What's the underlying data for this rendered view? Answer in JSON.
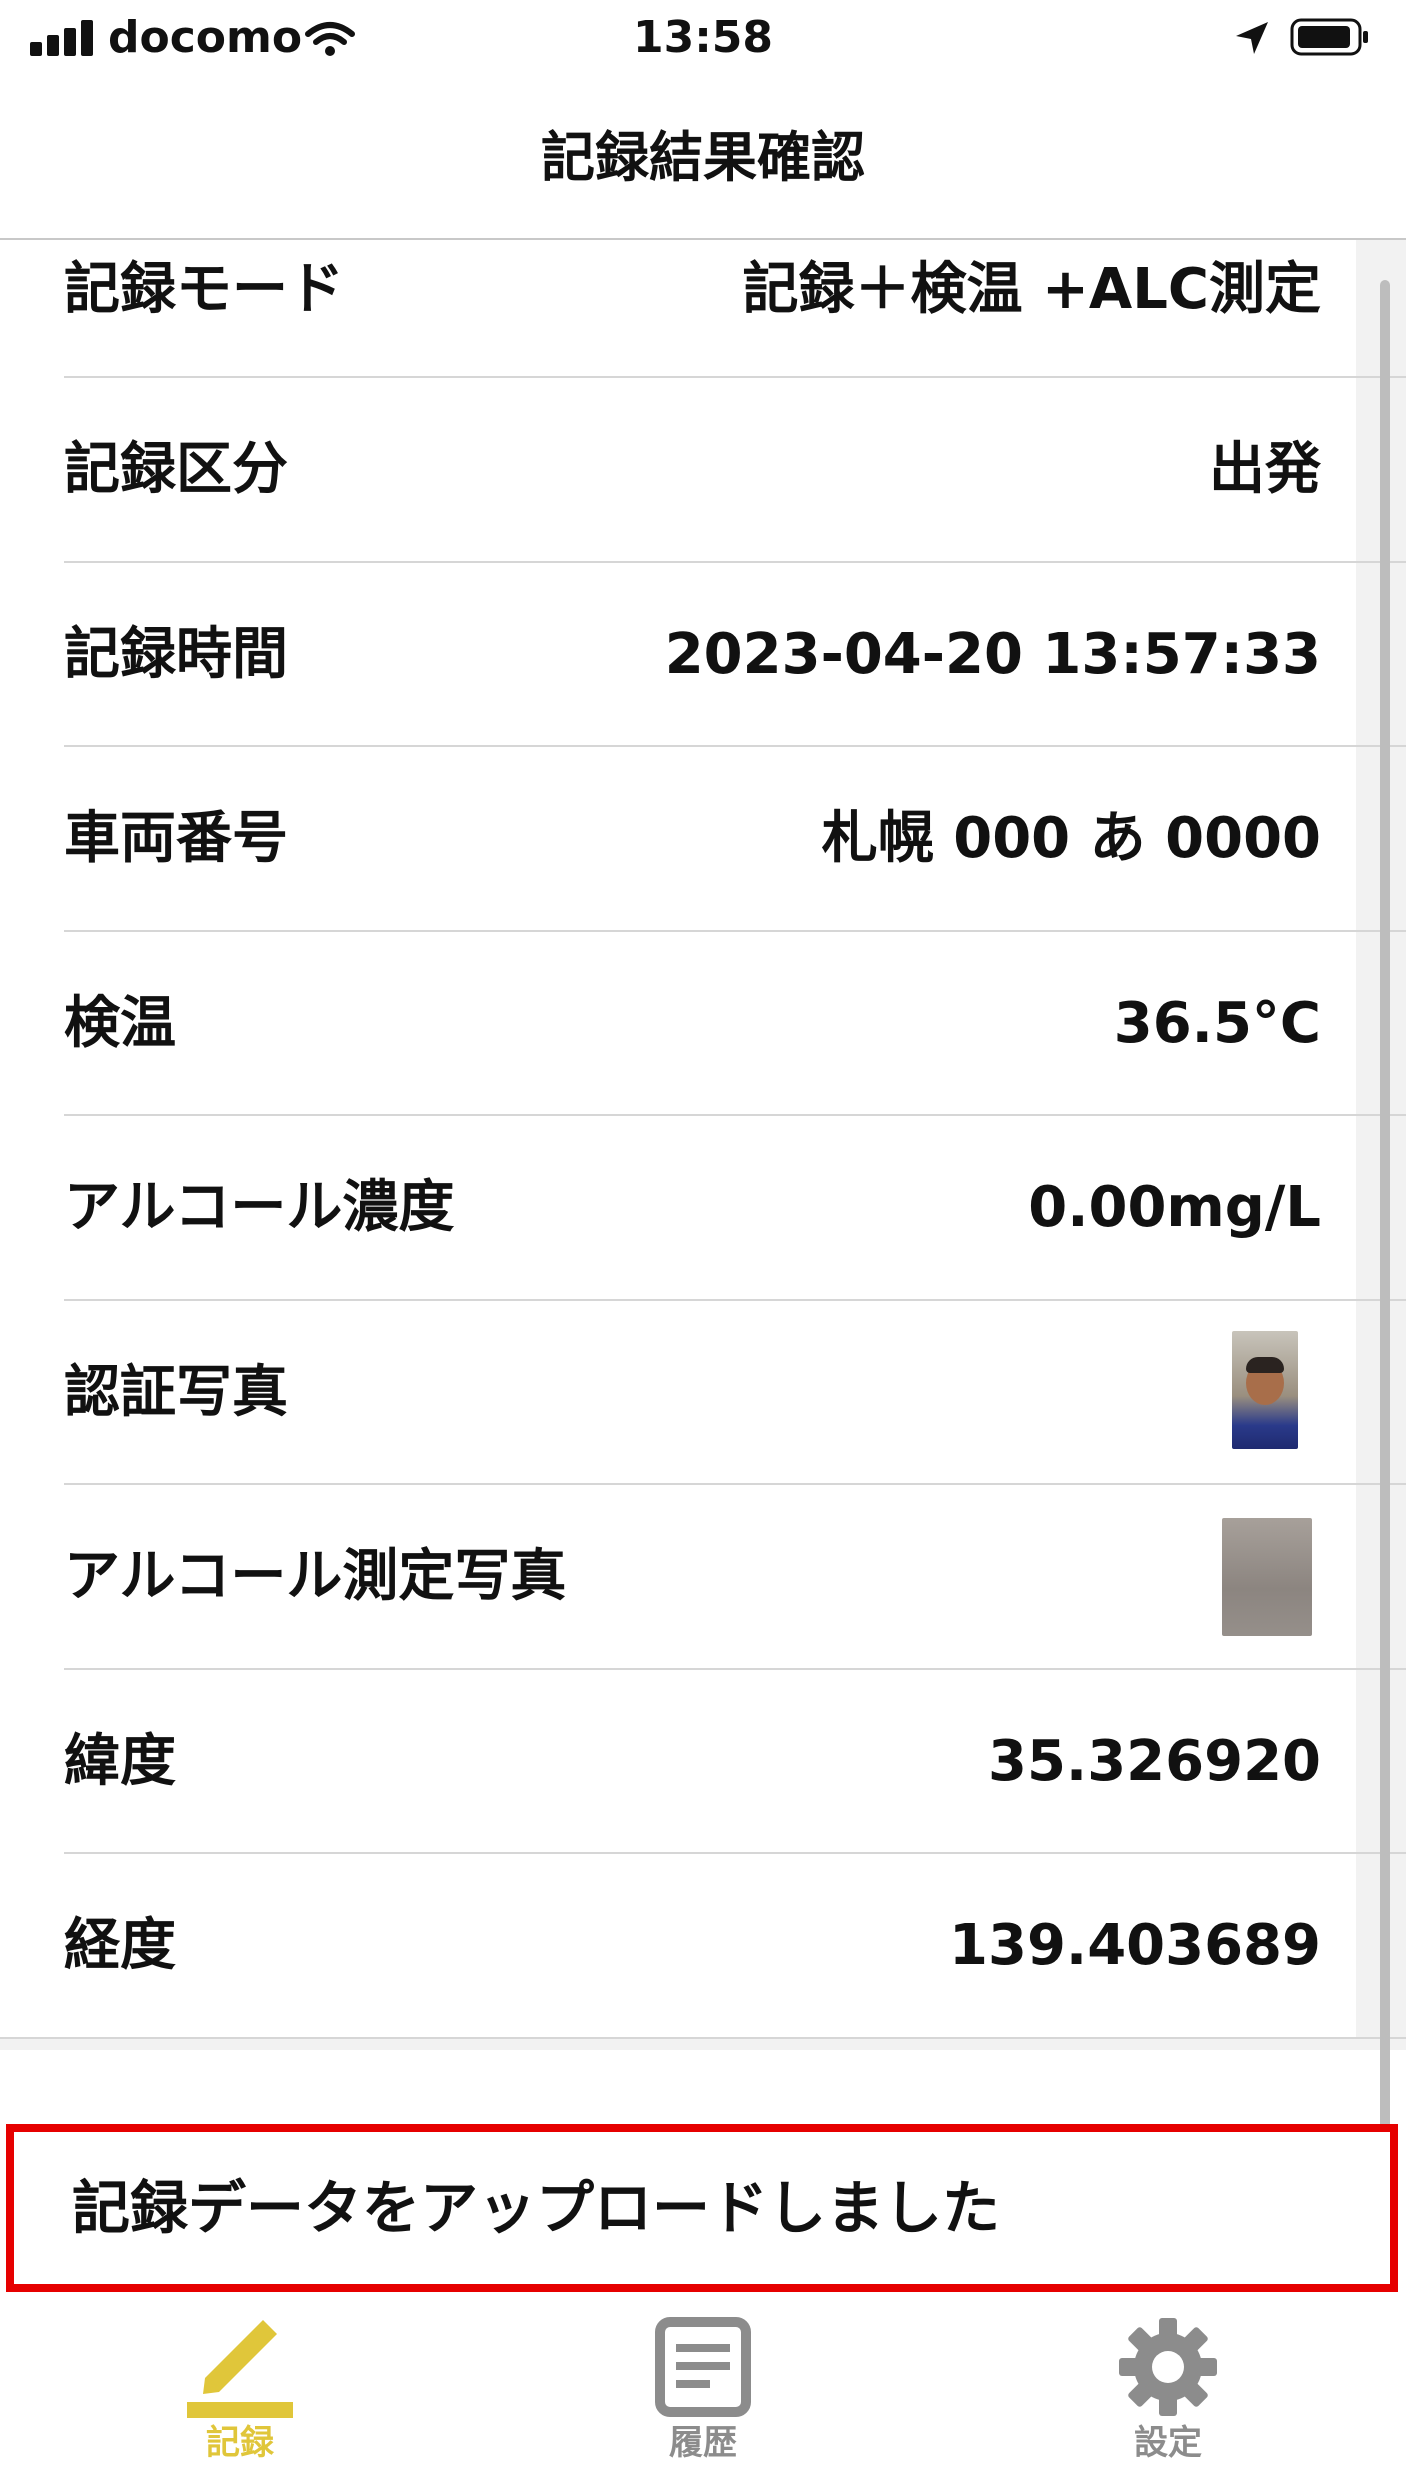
{
  "status_bar": {
    "carrier": "docomo",
    "time": "13:58"
  },
  "nav": {
    "title": "記録結果確認"
  },
  "rows": [
    {
      "label": "記録モード",
      "value": "記録＋検温 +ALC測定"
    },
    {
      "label": "記録区分",
      "value": "出発"
    },
    {
      "label": "記録時間",
      "value": "2023-04-20 13:57:33"
    },
    {
      "label": "車両番号",
      "value": "札幌 000 あ 0000"
    },
    {
      "label": "検温",
      "value": "36.5°C"
    },
    {
      "label": "アルコール濃度",
      "value": "0.00mg/L"
    },
    {
      "label": "認証写真"
    },
    {
      "label": "アルコール測定写真"
    },
    {
      "label": "緯度",
      "value": "35.326920"
    },
    {
      "label": "経度",
      "value": "139.403689"
    }
  ],
  "toast": {
    "message": "記録データをアップロードしました"
  },
  "tab_bar": {
    "items": [
      {
        "label": "記録",
        "icon": "pencil-icon",
        "active": true
      },
      {
        "label": "履歴",
        "icon": "document-icon",
        "active": false
      },
      {
        "label": "設定",
        "icon": "gear-icon",
        "active": false
      }
    ]
  },
  "colors": {
    "accent": "#e0c63a",
    "toast_border": "#e60000",
    "inactive": "#8c8c8c"
  }
}
